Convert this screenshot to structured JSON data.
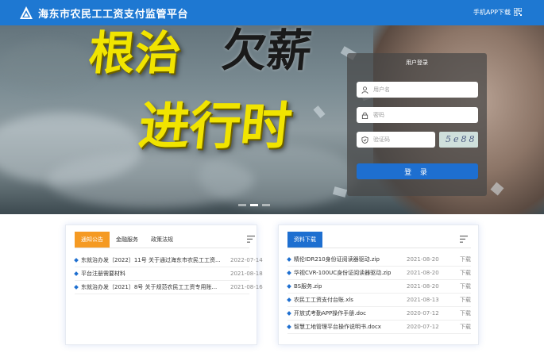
{
  "header": {
    "site_title": "海东市农民工工资支付监管平台",
    "app_download": "手机APP下载",
    "logo_icon": "mountain-logo-icon",
    "qr_icon": "qr-code-icon",
    "color": "#1e78d2"
  },
  "banner": {
    "slogan_part1": "根治",
    "slogan_part2": "欠薪",
    "slogan_line2": "进行时",
    "carousel_active": 2,
    "carousel_count": 3
  },
  "login": {
    "title": "用户登录",
    "username_placeholder": "用户名",
    "password_placeholder": "密码",
    "captcha_placeholder": "验证码",
    "captcha_text": "5e88",
    "submit_label": "登 录",
    "button_color": "#1e6fd0"
  },
  "notices": {
    "tabs": [
      {
        "label": "通知公告",
        "active": true
      },
      {
        "label": "金融服务",
        "active": false
      },
      {
        "label": "政策法规",
        "active": false
      }
    ],
    "items": [
      {
        "title": "东就治办发〔2022〕11号 关于通过海东市农民工工资...",
        "date": "2022-07-14"
      },
      {
        "title": "平台注册需要材料",
        "date": "2021-08-18"
      },
      {
        "title": "东就治办发〔2021〕8号 关于规范农民工工资专用账...",
        "date": "2021-08-16"
      }
    ]
  },
  "downloads": {
    "tabs": [
      {
        "label": "资料下载",
        "active": true
      }
    ],
    "download_label": "下载",
    "items": [
      {
        "title": "精伦IDR210身份证阅读器驱动.zip",
        "date": "2021-08-20"
      },
      {
        "title": "华视CVR-100UC身份证阅读器驱动.zip",
        "date": "2021-08-20"
      },
      {
        "title": "BS服务.zip",
        "date": "2021-08-20"
      },
      {
        "title": "农民工工资支付台账.xls",
        "date": "2021-08-13"
      },
      {
        "title": "开放式考勤APP操作手册.doc",
        "date": "2020-07-12"
      },
      {
        "title": "智慧工地管理平台操作说明书.docx",
        "date": "2020-07-12"
      }
    ]
  }
}
